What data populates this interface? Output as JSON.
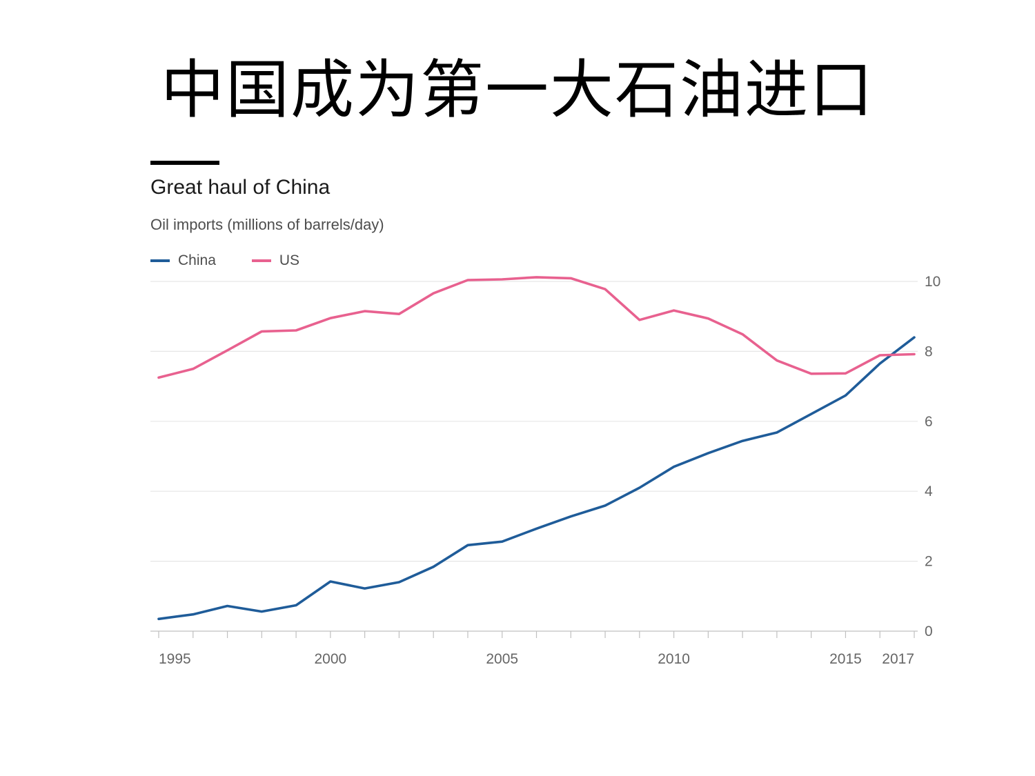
{
  "slide": {
    "title": "中国成为第一大石油进口"
  },
  "chart_data": {
    "type": "line",
    "title": "Great haul of China",
    "subtitle": "Oil imports (millions of barrels/day)",
    "xlabel": "",
    "ylabel": "",
    "x": [
      1995,
      1996,
      1997,
      1998,
      1999,
      2000,
      2001,
      2002,
      2003,
      2004,
      2005,
      2006,
      2007,
      2008,
      2009,
      2010,
      2011,
      2012,
      2013,
      2014,
      2015,
      2016,
      2017
    ],
    "xlim": [
      1995,
      2017
    ],
    "ylim": [
      0,
      10
    ],
    "x_tick_labels": [
      "1995",
      "2000",
      "2005",
      "2010",
      "2015",
      "2017"
    ],
    "x_ticks": [
      1995,
      2000,
      2005,
      2010,
      2015,
      2017
    ],
    "y_ticks": [
      0,
      2,
      4,
      6,
      8,
      10
    ],
    "y_tick_labels": [
      "0",
      "2",
      "4",
      "6",
      "8",
      "10"
    ],
    "y_axis_side": "right",
    "grid": true,
    "legend_position": "top-left",
    "series": [
      {
        "name": "China",
        "color": "#1f5c99",
        "values": [
          0.35,
          0.48,
          0.72,
          0.56,
          0.74,
          1.42,
          1.22,
          1.4,
          1.84,
          2.46,
          2.56,
          2.93,
          3.28,
          3.59,
          4.1,
          4.7,
          5.09,
          5.44,
          5.68,
          6.21,
          6.74,
          7.65,
          8.4
        ]
      },
      {
        "name": "US",
        "color": "#e8618f",
        "values": [
          7.25,
          7.5,
          8.03,
          8.57,
          8.6,
          8.95,
          9.15,
          9.07,
          9.66,
          10.04,
          10.06,
          10.12,
          10.09,
          9.78,
          8.9,
          9.17,
          8.94,
          8.49,
          7.74,
          7.36,
          7.37,
          7.89,
          7.92
        ]
      }
    ]
  }
}
